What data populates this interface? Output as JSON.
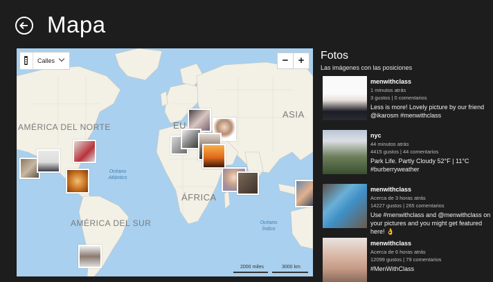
{
  "app": {
    "title": "Mapa"
  },
  "map": {
    "style_selector": "Calles",
    "zoom_out": "−",
    "zoom_in": "+",
    "labels": {
      "north_america": "AMÉRICA DEL NORTE",
      "south_america": "AMÉRICA DEL SUR",
      "europe": "EU",
      "asia": "ASIA",
      "africa": "ÁFRICA",
      "atlantic": "Océano Atlántico",
      "indian": "Océano Índico"
    },
    "scale": {
      "miles": "2000 miles",
      "km": "3000 km"
    }
  },
  "panel": {
    "title": "Fotos",
    "subtitle": "Las imágenes con las posiciones",
    "items": [
      {
        "user": "menwithclass",
        "time": "1 minutos atrás",
        "stats": "3 gustos | 0 comentarios",
        "caption": "Less is more! Lovely picture by our friend @ikarosm #menwithclass"
      },
      {
        "user": "nyc",
        "time": "44 minutos atrás",
        "stats": "4415 gustos | 44 comentarios",
        "caption": "Park Life. Partly Cloudy 52°F | 11°C #burberryweather"
      },
      {
        "user": "menwithclass",
        "time": "Acerca de 3 horas atrás",
        "stats": "14227 gustos | 265 comentarios",
        "caption": "Use #menwithclass and @menwithclass on your pictures and you might get featured here! 👌"
      },
      {
        "user": "menwithclass",
        "time": "Acerca de 6 horas atrás",
        "stats": "12099 gustos | 79 comentarios",
        "caption": "#MenWithClass"
      }
    ]
  },
  "colors": {
    "background": "#1d1d1d",
    "ocean": "#a9d0ee",
    "land": "#f2efe4"
  }
}
